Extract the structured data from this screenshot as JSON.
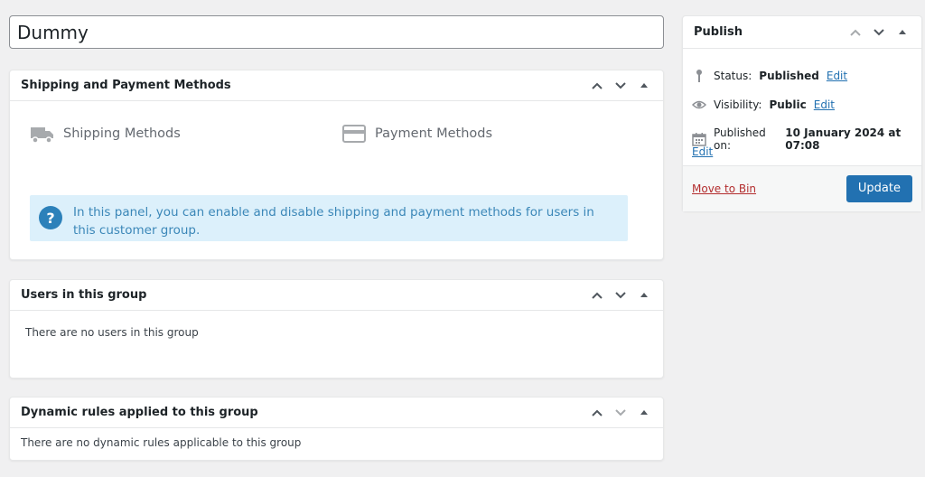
{
  "title_field": {
    "value": "Dummy"
  },
  "shipping_box": {
    "title": "Shipping and Payment Methods",
    "shipping_label": "Shipping Methods",
    "payment_label": "Payment Methods",
    "notice_text": "In this panel, you can enable and disable shipping and payment methods for users in this customer group.",
    "notice_icon": "?"
  },
  "users_box": {
    "title": "Users in this group",
    "empty_text": "There are no users in this group"
  },
  "rules_box": {
    "title": "Dynamic rules applied to this group",
    "empty_text": "There are no dynamic rules applicable to this group"
  },
  "publish_box": {
    "title": "Publish",
    "status_label": "Status:",
    "status_value": "Published",
    "visibility_label": "Visibility:",
    "visibility_value": "Public",
    "published_label": "Published on:",
    "published_value": "10 January 2024 at 07:08",
    "edit_label": "Edit",
    "move_to_bin": "Move to Bin",
    "update_label": "Update"
  },
  "colors": {
    "accent": "#2271b1",
    "danger": "#b32d2e",
    "notice_bg": "#dcf0fb",
    "notice_text": "#3b87b8"
  },
  "icons": [
    "chevron-up-icon",
    "chevron-down-icon",
    "toggle-arrow-icon",
    "truck-icon",
    "credit-card-icon",
    "help-icon",
    "pin-icon",
    "eye-icon",
    "calendar-icon"
  ]
}
